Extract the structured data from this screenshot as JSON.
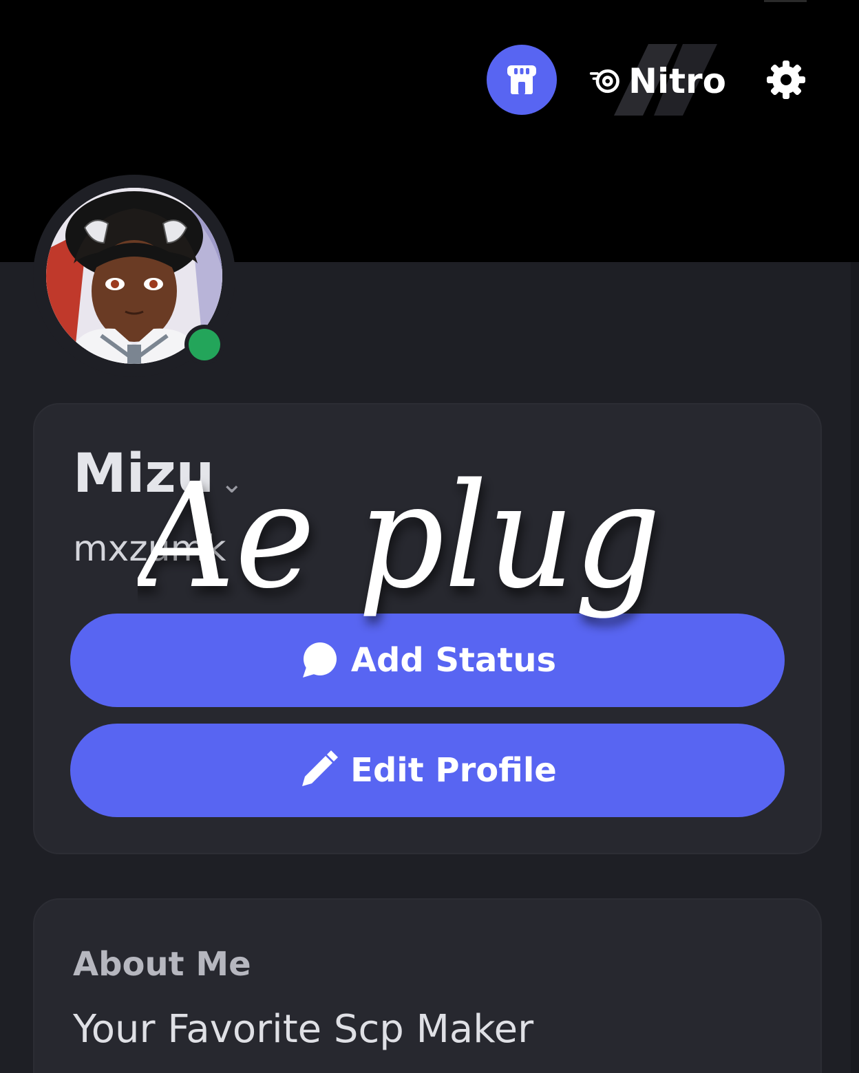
{
  "header": {
    "shop_icon": "shop-icon",
    "nitro_icon": "nitro-icon",
    "nitro_label": "Nitro",
    "settings_icon": "gear-icon"
  },
  "profile": {
    "avatar_icon": "avatar",
    "status": "online",
    "status_color": "#23a55a",
    "display_name": "Mizu",
    "display_name_chevron": "chevron-down-icon",
    "username": "mxzumk"
  },
  "actions": {
    "add_status_label": "Add Status",
    "add_status_icon": "chat-bubble-icon",
    "edit_profile_label": "Edit Profile",
    "edit_profile_icon": "pencil-icon"
  },
  "about": {
    "title": "About Me",
    "text": "Your Favorite Scp Maker"
  },
  "watermark": {
    "text": "Ae plug"
  },
  "colors": {
    "accent": "#5865f2",
    "background": "#1e1f25",
    "card": "#27282f",
    "header": "#000000"
  }
}
